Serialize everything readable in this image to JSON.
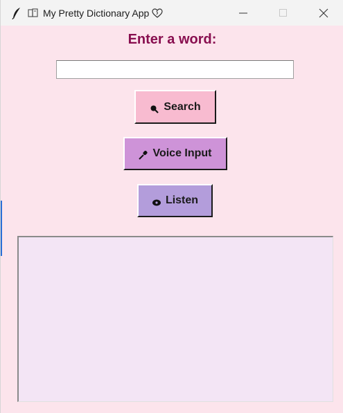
{
  "window": {
    "title": "My Pretty Dictionary App",
    "icons": {
      "app": "feather-icon",
      "title_emoji": "books-icon",
      "title_suffix": "heart-icon"
    },
    "controls": {
      "minimize": "minimize-icon",
      "maximize": "maximize-icon",
      "close": "close-icon"
    }
  },
  "main": {
    "heading": "Enter a word:",
    "word_input": {
      "value": "",
      "placeholder": ""
    },
    "buttons": {
      "search": {
        "label": "Search",
        "icon": "magnifier-icon"
      },
      "voice": {
        "label": "Voice Input",
        "icon": "microphone-icon"
      },
      "listen": {
        "label": "Listen",
        "icon": "speaker-icon"
      }
    },
    "result": {
      "text": ""
    }
  },
  "colors": {
    "background": "#fce4ec",
    "heading": "#880e4f",
    "search_button": "#f8bbd0",
    "voice_button": "#ce93d8",
    "listen_button": "#b39ddb",
    "result_area": "#f3e5f5"
  }
}
